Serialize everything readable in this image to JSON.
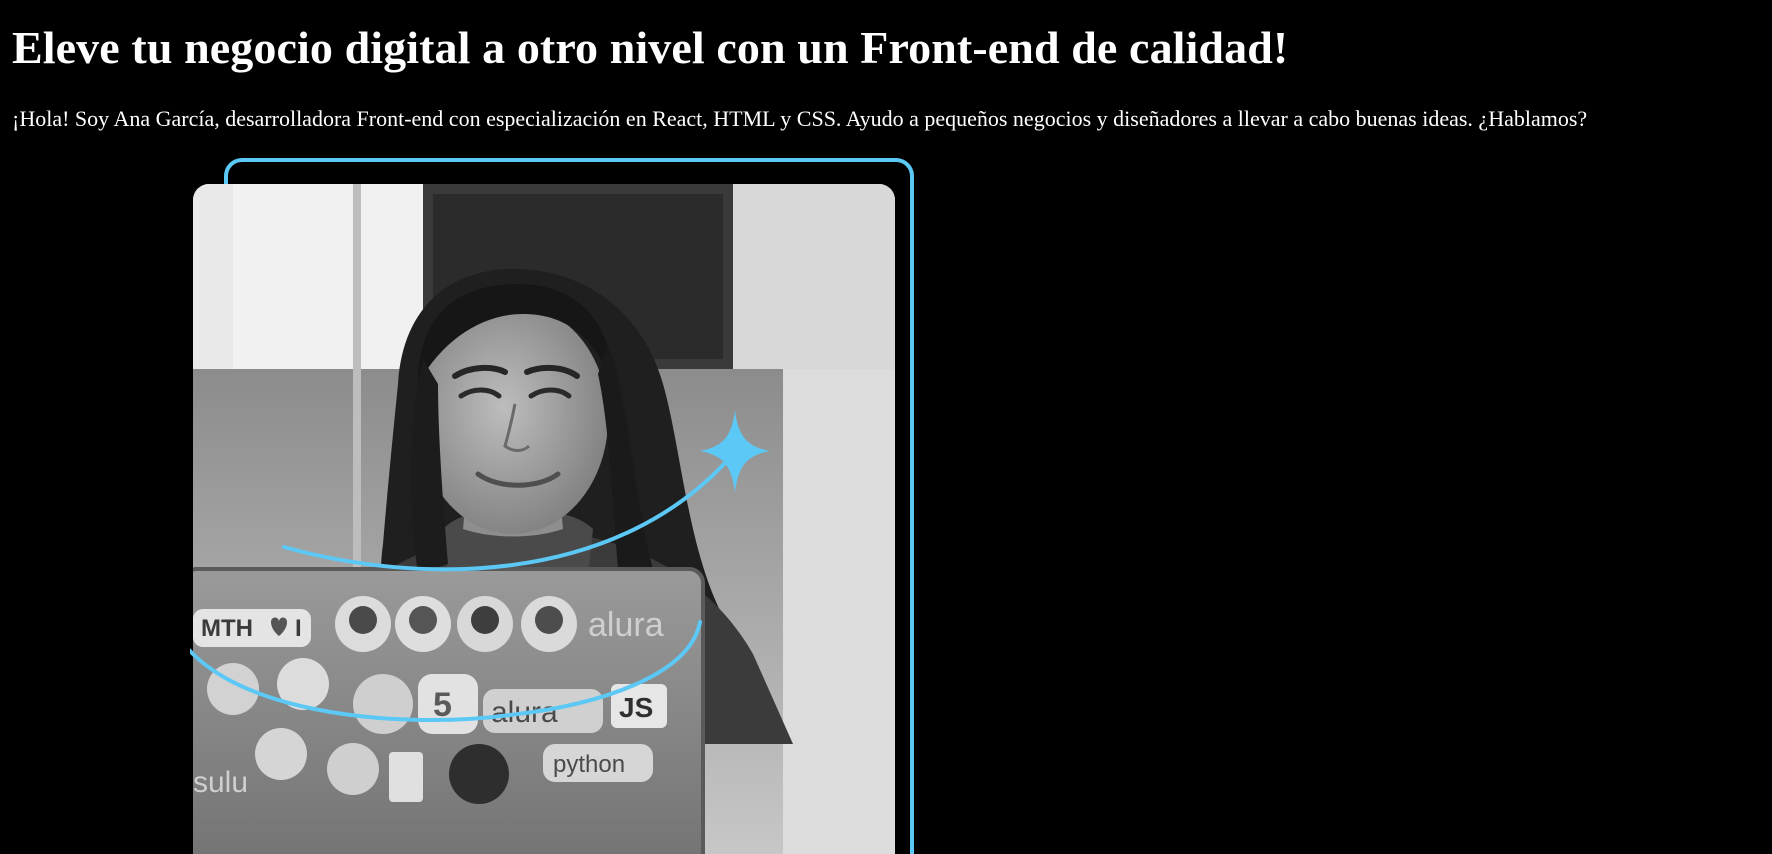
{
  "hero": {
    "headline": "Eleve tu negocio digital a otro nivel con un Front-end de calidad!",
    "intro": "¡Hola! Soy Ana García, desarrolladora Front-end con especialización en React, HTML y CSS. Ayudo a pequeños negocios y diseñadores a llevar a cabo buenas ideas. ¿Hablamos?"
  },
  "laptop_stickers": {
    "mth": "MTH",
    "i": "I",
    "alura_top": "alura",
    "alura_mid": "alura",
    "alura_side": "sulu",
    "js": "JS",
    "python": "python"
  },
  "colors": {
    "background": "#000000",
    "text": "#ffffff",
    "accent": "#5cc8f5"
  }
}
